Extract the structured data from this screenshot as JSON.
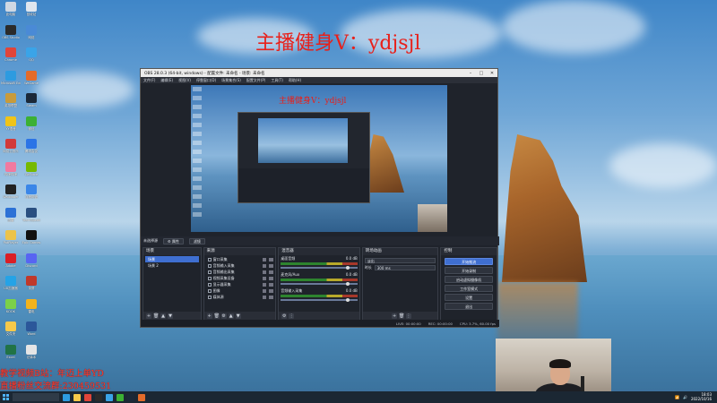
{
  "overlay": {
    "title": "主播健身V：ydjsjl",
    "left_line1": "教学视频B站：年迈上单YD",
    "left_line2": "直播粉丝交流群:230459531"
  },
  "desktop_icons": [
    {
      "label": "此电脑",
      "color": "#cfd8e3"
    },
    {
      "label": "回收站",
      "color": "#dfe6ee"
    },
    {
      "label": "OBS Studio",
      "color": "#2b2b2b"
    },
    {
      "label": "网络",
      "color": "#4a8ad6"
    },
    {
      "label": "Chrome",
      "color": "#e0453a"
    },
    {
      "label": "QQ",
      "color": "#3aa4e8"
    },
    {
      "label": "Microsoft Edge",
      "color": "#2d9be0"
    },
    {
      "label": "WeGame",
      "color": "#e36b2a"
    },
    {
      "label": "英雄联盟",
      "color": "#c89b3c"
    },
    {
      "label": "Steam",
      "color": "#1b2838"
    },
    {
      "label": "YY语音",
      "color": "#f0c419"
    },
    {
      "label": "微信",
      "color": "#3cb034"
    },
    {
      "label": "网易云音乐",
      "color": "#d23a3a"
    },
    {
      "label": "腾讯会议",
      "color": "#2b74e6"
    },
    {
      "label": "哔哩哔哩",
      "color": "#f07aa0"
    },
    {
      "label": "GeForce",
      "color": "#76b900"
    },
    {
      "label": "Wallpaper",
      "color": "#222"
    },
    {
      "label": "百度网盘",
      "color": "#3a86e8"
    },
    {
      "label": "迅雷",
      "color": "#2c71d6"
    },
    {
      "label": "TeamSpeak",
      "color": "#2a4f80"
    },
    {
      "label": "PotPlayer",
      "color": "#ecc34a"
    },
    {
      "label": "Epic Games",
      "color": "#111"
    },
    {
      "label": "Adobe",
      "color": "#da1f26"
    },
    {
      "label": "Discord",
      "color": "#5865f2"
    },
    {
      "label": "UU加速器",
      "color": "#25a3e6"
    },
    {
      "label": "录屏",
      "color": "#c0392b"
    },
    {
      "label": "KOOK",
      "color": "#7bd14a"
    },
    {
      "label": "雷电",
      "color": "#f3b31c"
    },
    {
      "label": "文件夹",
      "color": "#f6c94a"
    },
    {
      "label": "Word",
      "color": "#2b579a"
    },
    {
      "label": "Excel",
      "color": "#217346"
    },
    {
      "label": "记事本",
      "color": "#e5e5e5"
    }
  ],
  "obs": {
    "title": "OBS 28.0.3 (64-bit, windows) - 配置文件: 未命名 - 场景: 未命名",
    "menu": [
      "文件(F)",
      "编辑(E)",
      "视图(V)",
      "停靠窗口(D)",
      "场景集合(S)",
      "配置文件(P)",
      "工具(T)",
      "帮助(H)"
    ],
    "preview_overlay": "主播健身V：ydjsjl",
    "context_label": "未选择源",
    "context_buttons": [
      "属性",
      "滤镜"
    ],
    "scenes": {
      "title": "场景",
      "items": [
        "场景",
        "场景 2"
      ]
    },
    "sources": {
      "title": "来源",
      "items": [
        "窗口采集",
        "音频输入采集",
        "音频输出采集",
        "视频采集设备",
        "显示器采集",
        "图像",
        "媒体源"
      ]
    },
    "mixer": {
      "title": "混音器",
      "tracks": [
        {
          "name": "桌面音频",
          "db": "0.0 dB"
        },
        {
          "name": "麦克风/Aux",
          "db": "0.0 dB"
        },
        {
          "name": "音频输入采集",
          "db": "0.0 dB"
        }
      ]
    },
    "transitions": {
      "title": "转场动画",
      "type": "淡出",
      "duration_label": "时长",
      "duration": "300 ms"
    },
    "controls": {
      "title": "控制",
      "buttons": [
        "开始推流",
        "开始录制",
        "启动虚拟摄像机",
        "工作室模式",
        "设置",
        "退出"
      ]
    },
    "status": {
      "live": "LIVE: 00:00:00",
      "rec": "REC: 00:00:00",
      "cpu": "CPU: 3.7%, 60.00 fps"
    }
  },
  "taskbar": {
    "apps": [
      {
        "name": "edge",
        "color": "#2d9be0"
      },
      {
        "name": "folder",
        "color": "#f6c94a"
      },
      {
        "name": "chrome",
        "color": "#e0453a"
      },
      {
        "name": "obs",
        "color": "#2b2b2b"
      },
      {
        "name": "qq",
        "color": "#3aa4e8"
      },
      {
        "name": "wechat",
        "color": "#3cb034"
      },
      {
        "name": "steam",
        "color": "#1b2838"
      },
      {
        "name": "wegame",
        "color": "#e36b2a"
      }
    ],
    "time": "18:03",
    "date": "2022/10/16"
  }
}
